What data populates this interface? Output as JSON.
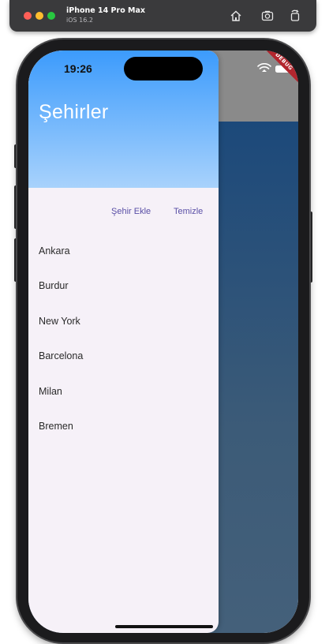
{
  "simulator": {
    "device_name": "iPhone 14 Pro Max",
    "os_version": "iOS 16.2",
    "toolbar_icons": [
      "home-icon",
      "screenshot-icon",
      "rotate-icon"
    ]
  },
  "status_bar": {
    "time": "19:26",
    "icons": [
      "wifi-icon",
      "battery-icon"
    ]
  },
  "debug_banner": "DEBUG",
  "drawer": {
    "title": "Şehirler",
    "actions": {
      "add_label": "Şehir Ekle",
      "clear_label": "Temizle"
    },
    "cities": [
      "Ankara",
      "Burdur",
      "New York",
      "Barcelona",
      "Milan",
      "Bremen"
    ]
  },
  "colors": {
    "header_top": "#3c9bfc",
    "header_bottom": "#a8d2fc",
    "drawer_bg": "#f6f1f8",
    "action_text": "#5a4fa6",
    "scrim_top": "#8a8a8a",
    "scrim_body": "#1c497a",
    "debug_banner": "#b3262e"
  }
}
